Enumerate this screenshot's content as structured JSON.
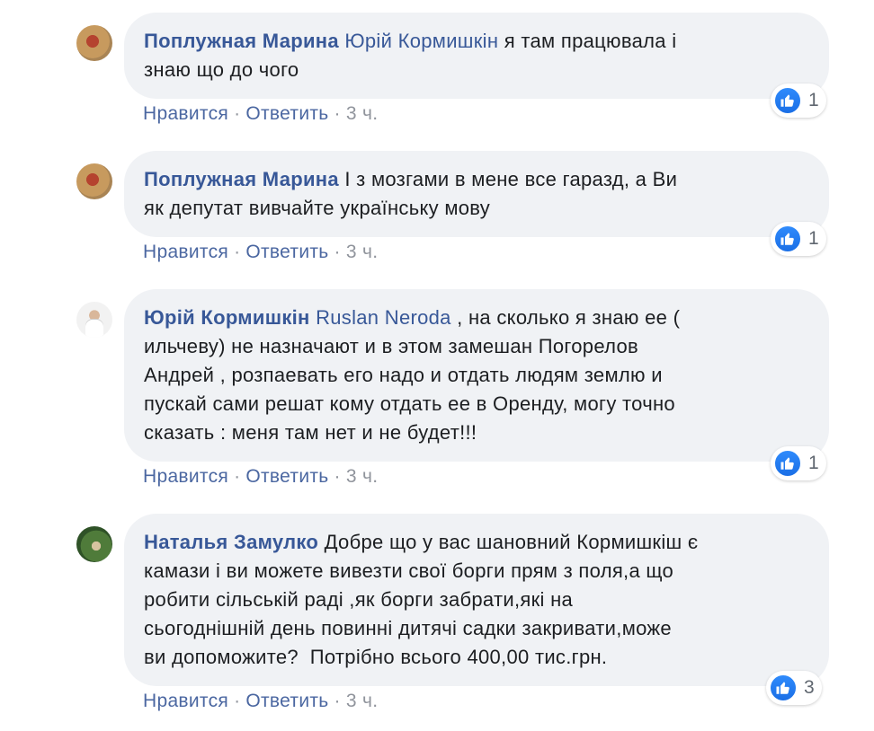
{
  "comments": [
    {
      "author": "Поплужная Марина",
      "mention": "Юрій Кормишкін",
      "text": "я там працювала і",
      "text2": "знаю що до чого",
      "like": "Нравится",
      "reply": "Ответить",
      "time": "3 ч.",
      "reactions": "1"
    },
    {
      "author": "Поплужная Марина",
      "text": "І з мозгами в мене все гаразд, а Ви",
      "text2": "як депутат вивчайте українську мову",
      "like": "Нравится",
      "reply": "Ответить",
      "time": "3 ч.",
      "reactions": "1"
    },
    {
      "author": "Юрій Кормишкін",
      "mention": "Ruslan Neroda",
      "text": ", на сколько я знаю ее (",
      "text2": "ильчеву) не назначают и в этом замешан Погорелов",
      "text3": "Андрей , розпаевать его надо и отдать людям землю и",
      "text4": "пускай сами решат кому отдать ее в Оренду, могу точно",
      "text5": "сказать : меня там нет и не будет!!!",
      "like": "Нравится",
      "reply": "Ответить",
      "time": "3 ч.",
      "reactions": "1"
    },
    {
      "author": "Наталья Замулко",
      "text": "Добре що у вас шановний Кормишкіш є",
      "text2": "камази і ви можете вивезти свої борги прям з поля,а що",
      "text3": "робити сільській раді ,як борги забрати,які на",
      "text4": "сьогоднішній день повинні дитячі садки закривати,може",
      "text5": "ви допоможите?  Потрібно всього 400,00 тис.грн.",
      "like": "Нравится",
      "reply": "Ответить",
      "time": "3 ч.",
      "reactions": "3"
    }
  ],
  "separator": "·",
  "colors": {
    "author": "#385898",
    "bubble": "#f0f2f5",
    "meta": "#90949c",
    "like_icon": "#1877f2"
  }
}
